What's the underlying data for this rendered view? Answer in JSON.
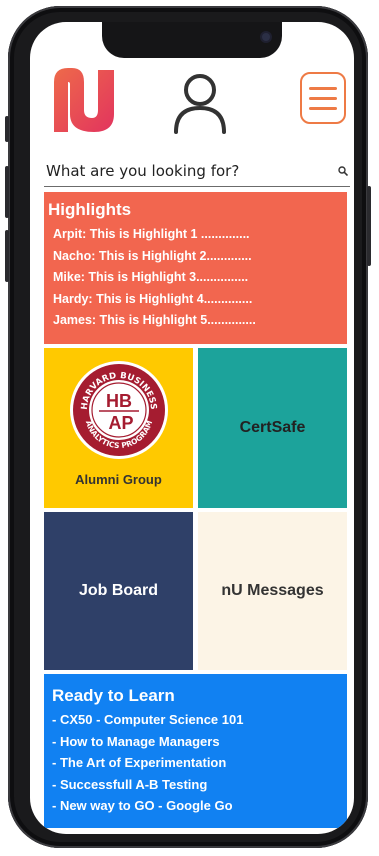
{
  "header": {
    "logo_icon": "nu-logo",
    "user_icon": "user-profile-icon",
    "menu_icon": "hamburger-menu-icon"
  },
  "search": {
    "placeholder": "What are you looking for?"
  },
  "highlights": {
    "title": "Highlights",
    "items": [
      "Arpit: This is Highlight 1 ..............",
      "Nacho: This is Highlight 2.............",
      "Mike: This is Highlight 3...............",
      "Hardy: This is Highlight 4..............",
      "James: This is Highlight 5.............."
    ],
    "color": "#f2664f"
  },
  "tiles": {
    "alumni": {
      "label": "Alumni Group",
      "seal_text_top": "HARVARD BUSINESS",
      "seal_text_bottom": "ANALYTICS PROGRAM",
      "seal_letters_top": "HB",
      "seal_letters_bottom": "AP",
      "color": "#ffc900"
    },
    "certsafe": {
      "label": "CertSafe",
      "color": "#1ca39b"
    },
    "jobboard": {
      "label": "Job Board",
      "color": "#2f4068"
    },
    "messages": {
      "label": "nU Messages",
      "color": "#fcf4e6"
    }
  },
  "learn": {
    "title": "Ready to Learn",
    "items": [
      "- CX50 - Computer Science 101",
      "- How to Manage Managers",
      "- The Art of Experimentation",
      "- Successfull A-B Testing",
      "- New way to GO - Google Go"
    ],
    "color": "#1181f2"
  },
  "colors": {
    "accent_orange": "#ee7a45",
    "logo_gradient_start": "#ee6a4a",
    "logo_gradient_end": "#e2345e"
  }
}
